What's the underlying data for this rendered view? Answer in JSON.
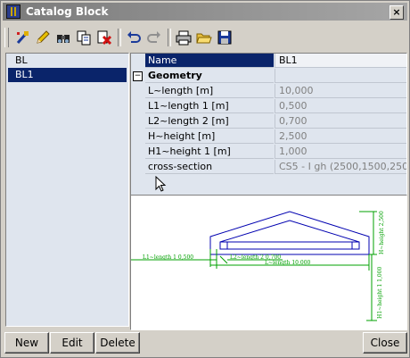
{
  "window": {
    "title": "Catalog Block"
  },
  "toolbar": {
    "icons": [
      "wand-icon",
      "pencil-icon",
      "binoculars-icon",
      "copy-icon",
      "delete-icon",
      "undo-icon",
      "redo-icon",
      "print-icon",
      "open-folder-icon",
      "save-icon"
    ]
  },
  "list": {
    "items": [
      "BL",
      "BL1"
    ],
    "selected": "BL1"
  },
  "properties": {
    "header": {
      "name": "Name",
      "value": "BL1"
    },
    "group": "Geometry",
    "rows": [
      {
        "name": "L~length [m]",
        "value": "10,000"
      },
      {
        "name": "L1~length 1 [m]",
        "value": "0,500"
      },
      {
        "name": "L2~length 2 [m]",
        "value": "0,700"
      },
      {
        "name": "H~height [m]",
        "value": "2,500"
      },
      {
        "name": "H1~height 1 [m]",
        "value": "1,000"
      },
      {
        "name": "cross-section",
        "value": "CS5 - I gh (2500,1500,250,..."
      }
    ]
  },
  "drawing": {
    "dim_l1": "L1~length 1 0,500",
    "dim_l2": "L2~length 2 0,700",
    "dim_l": "L~length 10,000",
    "dim_h": "H~height 2,500",
    "dim_h1": "H1~height 1 1,000"
  },
  "buttons": {
    "new": "New",
    "edit": "Edit",
    "delete": "Delete",
    "close": "Close"
  }
}
